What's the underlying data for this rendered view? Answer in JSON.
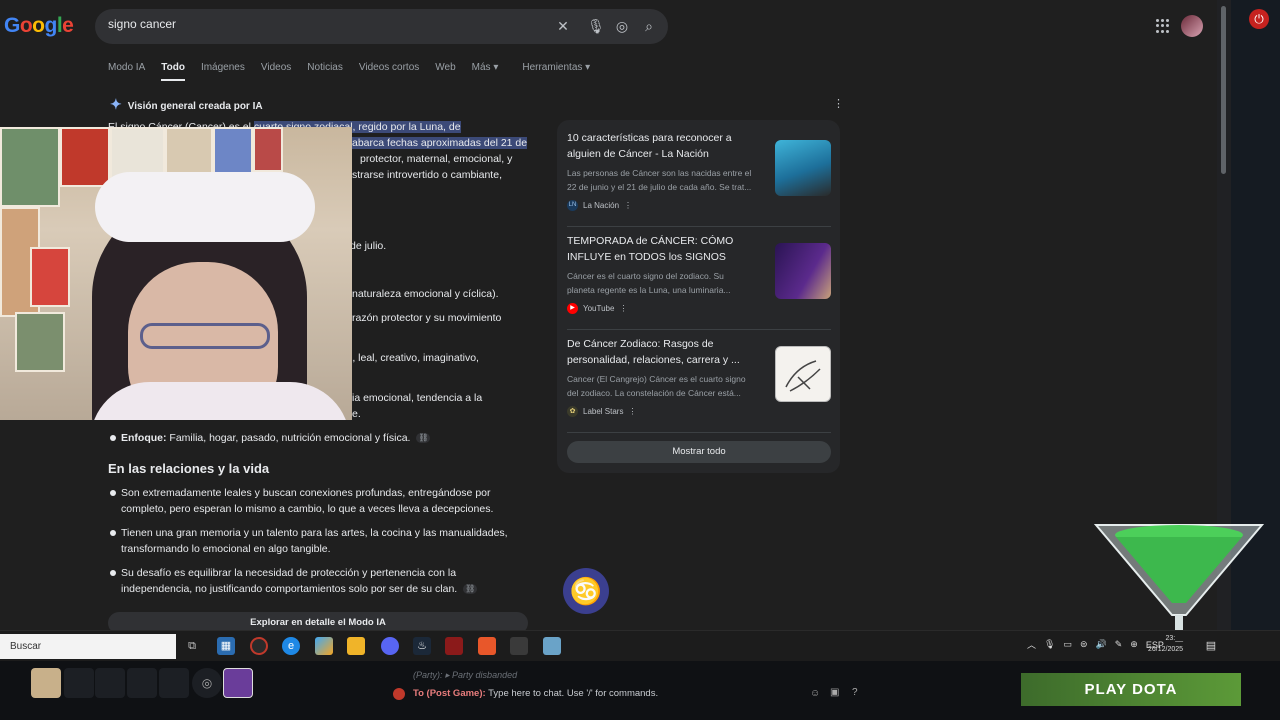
{
  "header": {
    "logo": [
      "G",
      "o",
      "o",
      "g",
      "l",
      "e"
    ],
    "query": "signo cancer"
  },
  "tabs": [
    "Modo IA",
    "Todo",
    "Imágenes",
    "Videos",
    "Noticias",
    "Videos cortos",
    "Web",
    "Más ▾",
    "Herramientas ▾"
  ],
  "active_tab": "Todo",
  "ai_overview": {
    "title": "Visión general creada por IA",
    "para_line1_a": "El signo Cáncer (Cancer) es el ",
    "para_line1_hl": "cuarto signo zodiacal, regido por la Luna, de",
    "para_line2_hl": "abarca fechas aproximadas del 21 de",
    "para_line3": "protector, maternal, emocional, y",
    "para_line4": "strarse introvertido o cambiante,",
    "frag_1": "de julio.",
    "frag_2": "naturaleza emocional y cíclica).",
    "frag_3": "razón protector y su movimiento",
    "frag_4": "l, leal, creativo, imaginativo,",
    "frag_5": "ia emocional, tendencia a la",
    "frag_6": "e.",
    "enfoque_label": "Enfoque:",
    "enfoque_text": " Familia, hogar, pasado, nutrición emocional y física.",
    "section_title": "En las relaciones y la vida",
    "bullets": [
      [
        "Son extremadamente leales y buscan conexiones profundas, entregándose por",
        "completo, pero esperan lo mismo a cambio, lo que a veces lleva a decepciones."
      ],
      [
        "Tienen una gran memoria y un talento para las artes, la cocina y las manualidades,",
        "transformando lo emocional en algo tangible."
      ],
      [
        "Su desafío es equilibrar la necesidad de protección y pertenencia con la",
        "independencia, no justificando comportamientos solo por ser de su clan."
      ]
    ],
    "explore_button": "Explorar en detalle el Modo IA"
  },
  "cards": [
    {
      "title": [
        "10 características para reconocer a",
        "alguien de Cáncer - La Nación"
      ],
      "desc": [
        "Las personas de Cáncer son las nacidas entre el",
        "22 de junio y el 21 de julio de cada año. Se trat..."
      ],
      "source": "La Nación",
      "fav_text": "LN"
    },
    {
      "title": [
        "TEMPORADA de CÁNCER: CÓMO",
        "INFLUYE en TODOS los SIGNOS"
      ],
      "desc": [
        "Cáncer es el cuarto signo del zodiaco. Su",
        "planeta regente es la Luna, una luminaria..."
      ],
      "source": "YouTube",
      "fav_text": "▶"
    },
    {
      "title": [
        "De Cáncer Zodiaco: Rasgos de",
        "personalidad, relaciones, carrera y ..."
      ],
      "desc": [
        "Cancer (El Cangrejo) Cáncer es el cuarto signo",
        "del zodiaco. La constelación de Cáncer está..."
      ],
      "source": "Label Stars",
      "fav_text": "✿"
    }
  ],
  "show_all": "Mostrar todo",
  "cancer_symbol": "♋",
  "taskbar": {
    "search_label": "Buscar",
    "tray_lang": "ESP",
    "time": "23:__",
    "date": "26/12/2025"
  },
  "game": {
    "chat_line_prefix": "(Party):",
    "chat_line": "Party disbanded",
    "chat_to": "To (Post Game):",
    "chat_placeholder": "Type here to chat. Use '/' for commands.",
    "play_button": "PLAY DOTA"
  },
  "colors": {
    "background": "#1f1f1f",
    "highlight": "#3c4a78",
    "accent_blue": "#8ab4f8",
    "play_green": "#5c9a38"
  }
}
